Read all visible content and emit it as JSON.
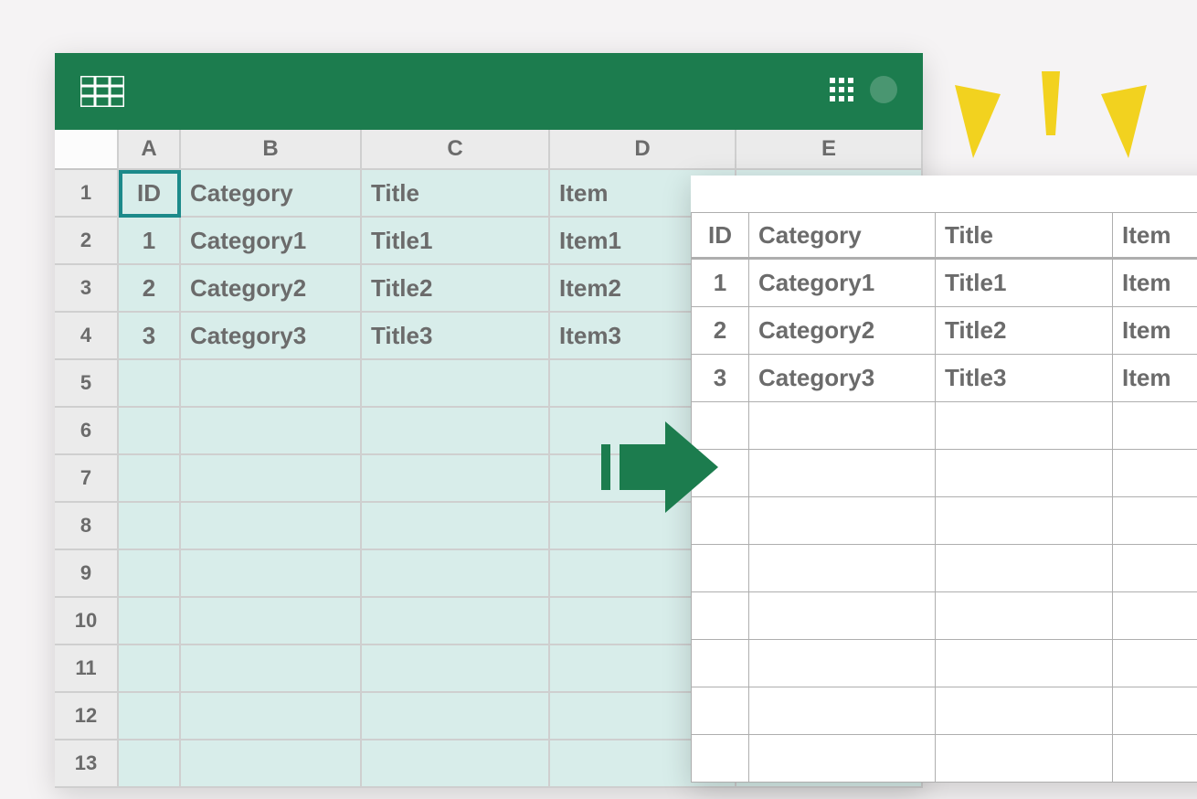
{
  "spreadsheet": {
    "columns": [
      "A",
      "B",
      "C",
      "D",
      "E"
    ],
    "row_numbers": [
      "1",
      "2",
      "3",
      "4",
      "5",
      "6",
      "7",
      "8",
      "9",
      "10",
      "11",
      "12",
      "13"
    ],
    "cells": {
      "r1": {
        "a": "ID",
        "b": "Category",
        "c": "Title",
        "d": "Item"
      },
      "r2": {
        "a": "1",
        "b": "Category1",
        "c": "Title1",
        "d": "Item1"
      },
      "r3": {
        "a": "2",
        "b": "Category2",
        "c": "Title2",
        "d": "Item2"
      },
      "r4": {
        "a": "3",
        "b": "Category3",
        "c": "Title3",
        "d": "Item3"
      }
    }
  },
  "output": {
    "header": {
      "a": "ID",
      "b": "Category",
      "c": "Title",
      "d": "Item"
    },
    "rows": {
      "r1": {
        "a": "1",
        "b": "Category1",
        "c": "Title1",
        "d": "Item"
      },
      "r2": {
        "a": "2",
        "b": "Category2",
        "c": "Title2",
        "d": "Item"
      },
      "r3": {
        "a": "3",
        "b": "Category3",
        "c": "Title3",
        "d": "Item"
      }
    }
  }
}
